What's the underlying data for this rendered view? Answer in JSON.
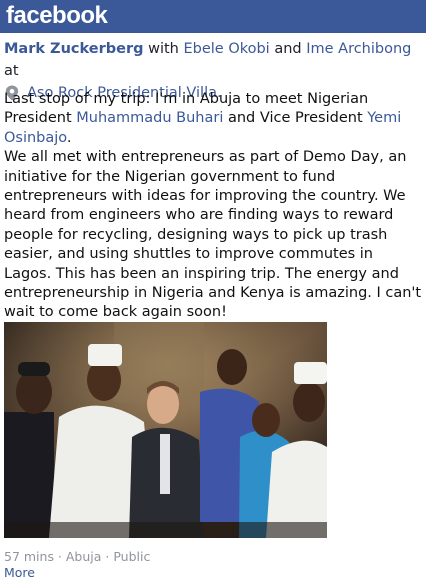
{
  "app": {
    "brand": "facebook",
    "brand_color": "#3b5998"
  },
  "post": {
    "author": "Mark Zuckerberg",
    "with_word": " with ",
    "tag1": "Ebele Okobi",
    "and_word": " and ",
    "tag2": "Ime Archibong",
    "at_word": " at",
    "place": "Aso Rock Presidential Villa.",
    "text_p1_a": "Last stop of my trip: I'm in Abuja to meet Nigerian President ",
    "text_p1_link1": "Muhammadu Buhari",
    "text_p1_b": " and Vice President ",
    "text_p1_link2": "Yemi Osinbajo",
    "text_p1_c": ".",
    "text_p2": "We all met with entrepreneurs as part of Demo Day, an initiative for the Nigerian government to fund entrepreneurs with ideas for improving the country. We heard from engineers who are finding ways to reward people for recycling, designing ways to pick up trash easier, and using shuttles to improve commutes in Lagos. This has been an inspiring trip. The energy and entrepreneurship in Nigeria and Kenya is amazing. I can't wait to come back again soon!",
    "timestamp": "57 mins · Abuja · Public",
    "more_label": "More",
    "icons": {
      "place": "location-pin-icon"
    }
  }
}
